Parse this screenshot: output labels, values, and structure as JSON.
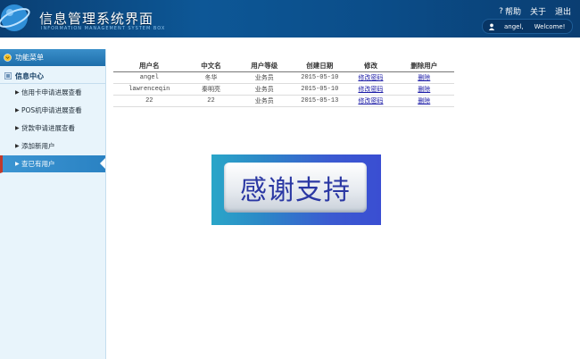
{
  "header": {
    "title": "信息管理系统界面",
    "subtitle": "INFORMATION MANAGEMENT SYSTEM BOX",
    "links": [
      "帮助",
      "关于",
      "退出"
    ],
    "username": "angel,",
    "welcome": "Welcome!"
  },
  "sidebar": {
    "title": "功能菜单",
    "section": "信息中心",
    "items": [
      {
        "label": "信用卡申请进展查看"
      },
      {
        "label": "POS机申请进展查看"
      },
      {
        "label": "贷款申请进展查看"
      },
      {
        "label": "添加新用户"
      },
      {
        "label": "查已有用户"
      }
    ]
  },
  "table": {
    "headers": [
      "用户名",
      "中文名",
      "用户等级",
      "创建日期",
      "修改",
      "删除用户"
    ],
    "rows": [
      [
        "angel",
        "冬华",
        "业务员",
        "2015-05-10",
        "修改密码",
        "删除"
      ],
      [
        "lawrenceqin",
        "秦明亮",
        "业务员",
        "2015-05-10",
        "修改密码",
        "删除"
      ],
      [
        "22",
        "22",
        "业务员",
        "2015-05-13",
        "修改密码",
        "删除"
      ]
    ]
  },
  "banner": {
    "text": "感谢支持"
  },
  "colors": {
    "header": "#0d5796",
    "accent": "#2a82c3",
    "link": "#1a1aa6"
  }
}
